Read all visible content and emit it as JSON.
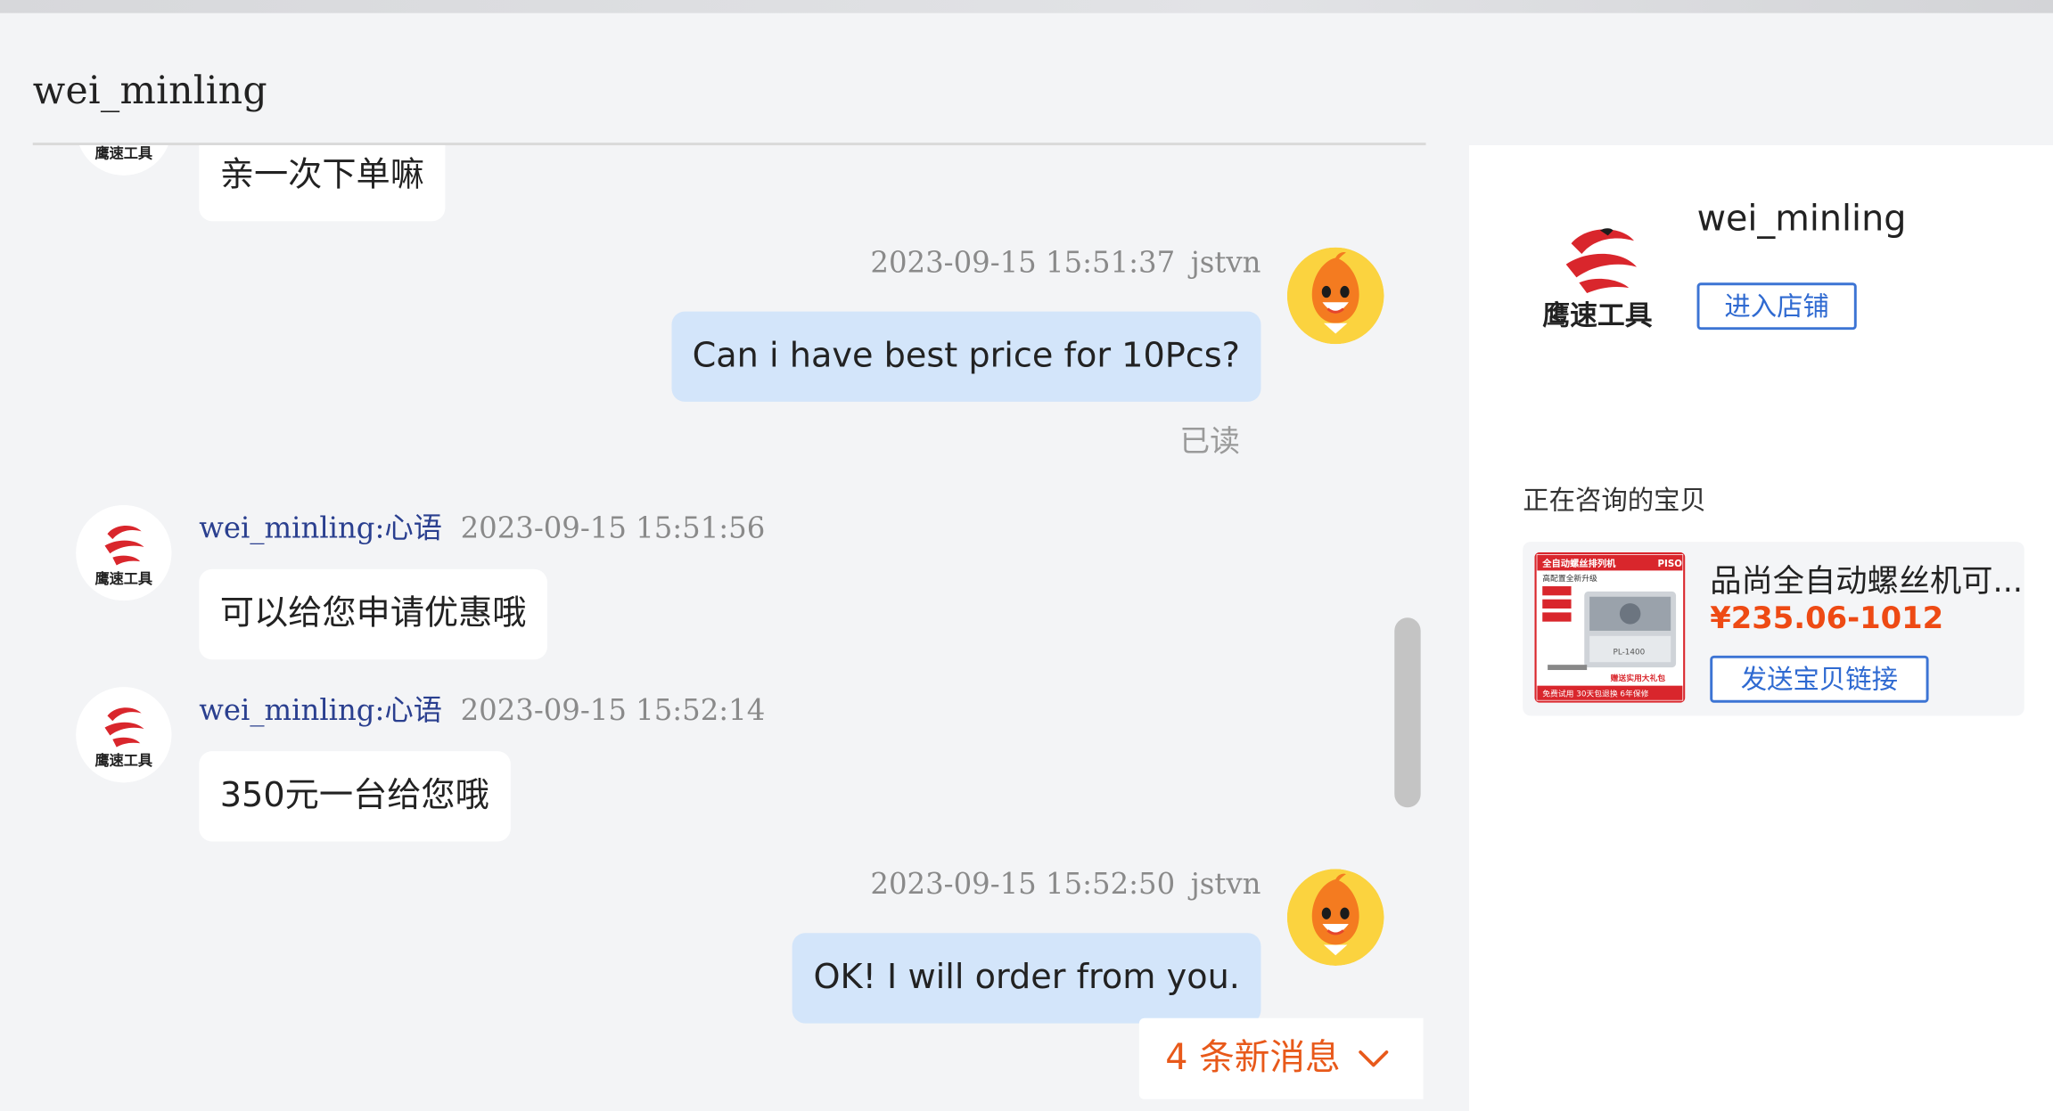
{
  "header": {
    "title": "wei_minling"
  },
  "messages": [
    {
      "side": "left",
      "text": "亲一次下单嘛"
    },
    {
      "side": "right",
      "time": "2023-09-15 15:51:37",
      "sender": "jstvn",
      "text": "Can i have best price for 10Pcs?",
      "read": "已读"
    },
    {
      "side": "left",
      "sender": "wei_minling:心语",
      "time": "2023-09-15 15:51:56",
      "text": "可以给您申请优惠哦"
    },
    {
      "side": "left",
      "sender": "wei_minling:心语",
      "time": "2023-09-15 15:52:14",
      "text": "350元一台给您哦"
    },
    {
      "side": "right",
      "time": "2023-09-15 15:52:50",
      "sender": "jstvn",
      "text": "OK! I will order from you."
    }
  ],
  "new_messages": {
    "label": "4 条新消息",
    "icon": "chevron-down-icon"
  },
  "sidebar": {
    "shop_name": "wei_minling",
    "enter_store_label": "进入店铺",
    "consulting_title": "正在咨询的宝贝",
    "shop_logo_text": "鹰速工具",
    "product": {
      "name": "品尚全自动螺丝机可...",
      "price": "¥235.06-1012",
      "send_link_label": "发送宝贝链接",
      "thumb_texts": {
        "headline": "全自动螺丝排列机",
        "brand": "PISO",
        "sub": "高配置全新升级",
        "model": "PL-1400",
        "gift": "赠送实用大礼包",
        "footer": "免费试用 30天包退换 6年保修"
      }
    }
  },
  "colors": {
    "background": "#f3f4f6",
    "left_bubble": "#ffffff",
    "right_bubble": "#d3e5fa",
    "sender_link": "#2a3f8f",
    "button_blue": "#2f6ad1",
    "price": "#ee4a14",
    "new_msg": "#e8591a"
  }
}
